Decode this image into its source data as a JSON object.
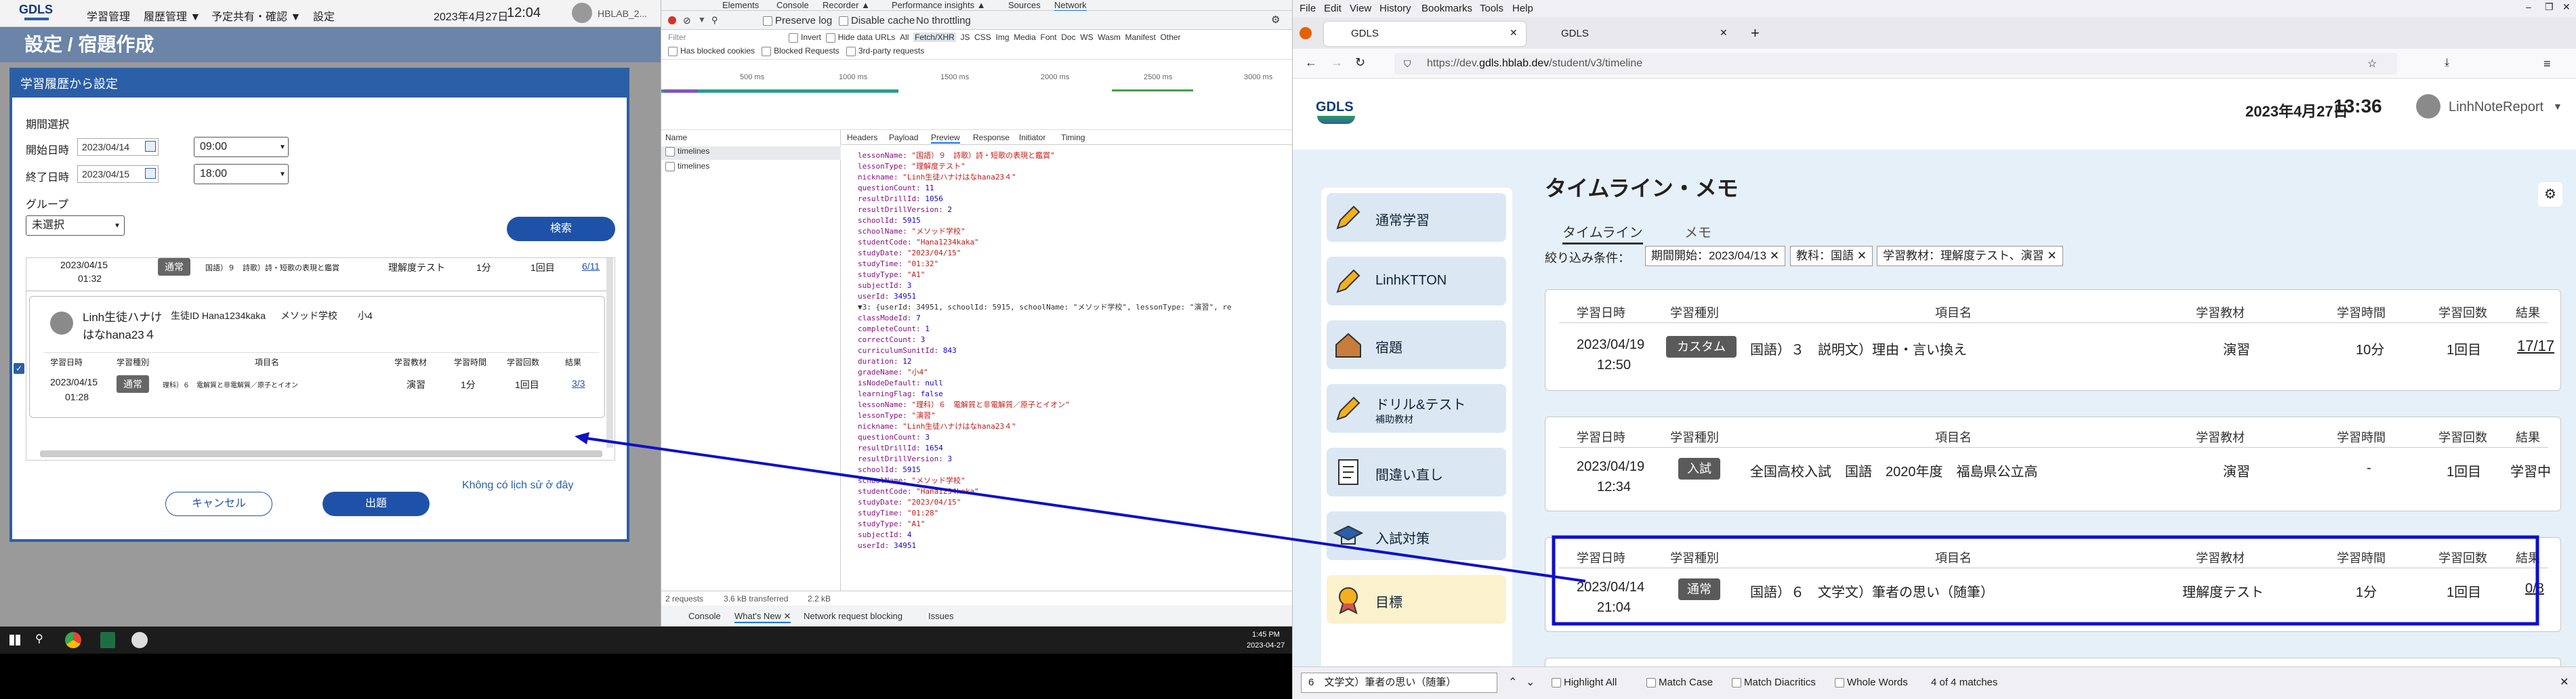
{
  "left_app": {
    "logo": "GDLS",
    "menu": [
      "学習管理",
      "履歴管理 ▼",
      "予定共有・確認 ▼",
      "設定"
    ],
    "datetime": "2023年4月27日",
    "time": "12:04",
    "user": "HBLAB_2...",
    "page_title": "設定 / 宿題作成",
    "modal": {
      "title": "学習履歴から設定",
      "period_label": "期間選択",
      "start_label": "開始日時",
      "start_date": "2023/04/14",
      "start_time": "09:00",
      "end_label": "終了日時",
      "end_date": "2023/04/15",
      "end_time": "18:00",
      "group_label": "グループ",
      "group_value": "未選択",
      "search_button": "検索",
      "row1": {
        "date": "2023/04/15",
        "time": "01:32",
        "badge": "通常",
        "item": "国語）９　詩歌）詩・短歌の表現と鑑賞",
        "material": "理解度テスト",
        "duration": "1分",
        "count": "1回目",
        "result": "6/11"
      },
      "student": {
        "name_line1": "Linh生徒ハナけ",
        "name_line2": "はなhana23４",
        "id_label": "生徒ID Hana1234kaka",
        "school": "メソッド学校",
        "grade": "小4"
      },
      "headers": [
        "学習日時",
        "学習種別",
        "項目名",
        "学習教材",
        "学習時間",
        "学習回数",
        "結果"
      ],
      "row2": {
        "date": "2023/04/15",
        "time": "01:28",
        "badge": "通常",
        "item": "理科）６　電解質と非電解質／原子とイオン",
        "material": "演習",
        "duration": "1分",
        "count": "1回目",
        "result": "3/3"
      },
      "cancel_button": "キャンセル",
      "submit_button": "出題",
      "note": "Không có lịch sử ở đây"
    }
  },
  "devtools": {
    "tabs": [
      "Elements",
      "Console",
      "Recorder ▲",
      "Performance insights ▲",
      "Sources",
      "Network"
    ],
    "preserve_log": "Preserve log",
    "disable_cache": "Disable cache",
    "throttling": "No throttling",
    "filter_placeholder": "Filter",
    "filter_opts": [
      "Invert",
      "Hide data URLs",
      "All",
      "Fetch/XHR",
      "JS",
      "CSS",
      "Img",
      "Media",
      "Font",
      "Doc",
      "WS",
      "Wasm",
      "Manifest",
      "Other"
    ],
    "filter_opts2": [
      "Has blocked cookies",
      "Blocked Requests",
      "3rd-party requests"
    ],
    "timeline_ticks": [
      "500 ms",
      "1000 ms",
      "1500 ms",
      "2000 ms",
      "2500 ms",
      "3000 ms"
    ],
    "name_header": "Name",
    "requests": [
      "timelines",
      "timelines"
    ],
    "detail_tabs": [
      "Headers",
      "Payload",
      "Preview",
      "Response",
      "Initiator",
      "Timing"
    ],
    "code_lines": [
      "lessonName: \"国語）９　詩歌）詩・短歌の表現と鑑賞\"",
      "lessonType: \"理解度テスト\"",
      "nickname: \"Linh生徒ハナけはなhana23４\"",
      "questionCount: 11",
      "resultDrillId: 1056",
      "resultDrillVersion: 2",
      "schoolId: 5915",
      "schoolName: \"メソッド学校\"",
      "studentCode: \"Hana1234kaka\"",
      "studyDate: \"2023/04/15\"",
      "studyTime: \"01:32\"",
      "studyType: \"A1\"",
      "subjectId: 3",
      "userId: 34951",
      "▼3: {userId: 34951, schoolId: 5915, schoolName: \"メソッド学校\", lessonType: \"演習\", re",
      "classModeId: 7",
      "completeCount: 1",
      "correctCount: 3",
      "curriculumSunitId: 843",
      "duration: 12",
      "gradeName: \"小4\"",
      "isNodeDefault: null",
      "learningFlag: false",
      "lessonName: \"理科）６　電解質と非電解質／原子とイオン\"",
      "lessonType: \"演習\"",
      "nickname: \"Linh生徒ハナけはなhana23４\"",
      "questionCount: 3",
      "resultDrillId: 1654",
      "resultDrillVersion: 3",
      "schoolId: 5915",
      "schoolName: \"メソッド学校\"",
      "studentCode: \"Hana1234kaka\"",
      "studyDate: \"2023/04/15\"",
      "studyTime: \"01:28\"",
      "studyType: \"A1\"",
      "subjectId: 4",
      "userId: 34951"
    ],
    "status": [
      "2 requests",
      "3.6 kB transferred",
      "2.2 kB"
    ],
    "drawer_tabs": [
      "Console",
      "What's New ✕",
      "Network request blocking",
      "Issues"
    ]
  },
  "taskbar": {
    "time": "1:45 PM",
    "date": "2023-04-27"
  },
  "firefox": {
    "menu": [
      "File",
      "Edit",
      "View",
      "History",
      "Bookmarks",
      "Tools",
      "Help"
    ],
    "tabs": [
      "GDLS",
      "GDLS"
    ],
    "url_prefix": "https://dev.",
    "url_domain": "gdls.hblab.dev",
    "url_path": "/student/v3/timeline",
    "page": {
      "logo": "GDLS",
      "date": "2023年4月27日",
      "time": "13:36",
      "user": "LinhNoteReport",
      "title": "タイムライン・メモ",
      "tab_timeline": "タイムライン",
      "tab_memo": "メモ",
      "filter_label": "絞り込み条件：",
      "filters": [
        "期間開始：2023/04/13",
        "教科：国語",
        "学習教材：理解度テスト、演習"
      ],
      "sidebar": [
        {
          "label": "通常学習",
          "sub": ""
        },
        {
          "label": "LinhKTTON",
          "sub": ""
        },
        {
          "label": "宿題",
          "sub": ""
        },
        {
          "label": "ドリル&テスト",
          "sub": "補助教材"
        },
        {
          "label": "間違い直し",
          "sub": ""
        },
        {
          "label": "入試対策",
          "sub": ""
        },
        {
          "label": "目標",
          "sub": ""
        }
      ],
      "headers": [
        "学習日時",
        "学習種別",
        "項目名",
        "学習教材",
        "学習時間",
        "学習回数",
        "結果"
      ],
      "cards": [
        {
          "date": "2023/04/19",
          "time": "12:50",
          "badge": "カスタム",
          "item": "国語）３　説明文）理由・言い換え",
          "material": "演習",
          "duration": "10分",
          "count": "1回目",
          "result": "17/17"
        },
        {
          "date": "2023/04/19",
          "time": "12:34",
          "badge": "入試",
          "item": "全国高校入試　国語　2020年度　福島県公立高",
          "material": "演習",
          "duration": "-",
          "count": "1回目",
          "result": "学習中"
        },
        {
          "date": "2023/04/14",
          "time": "21:04",
          "badge": "通常",
          "item": "国語）６　文学文）筆者の思い（随筆）",
          "material": "理解度テスト",
          "duration": "1分",
          "count": "1回目",
          "result": "0/8"
        }
      ]
    },
    "findbar": {
      "query": "6　文学文）筆者の思い（随筆）",
      "opts": [
        "Highlight All",
        "Match Case",
        "Match Diacritics",
        "Whole Words"
      ],
      "matches": "4 of 4 matches"
    }
  },
  "colors": {
    "brand_blue": "#1e52a8",
    "annotation": "#1010c8",
    "sidebar_bg": "#e3eef7",
    "goal_bg": "#fbf1cc"
  }
}
